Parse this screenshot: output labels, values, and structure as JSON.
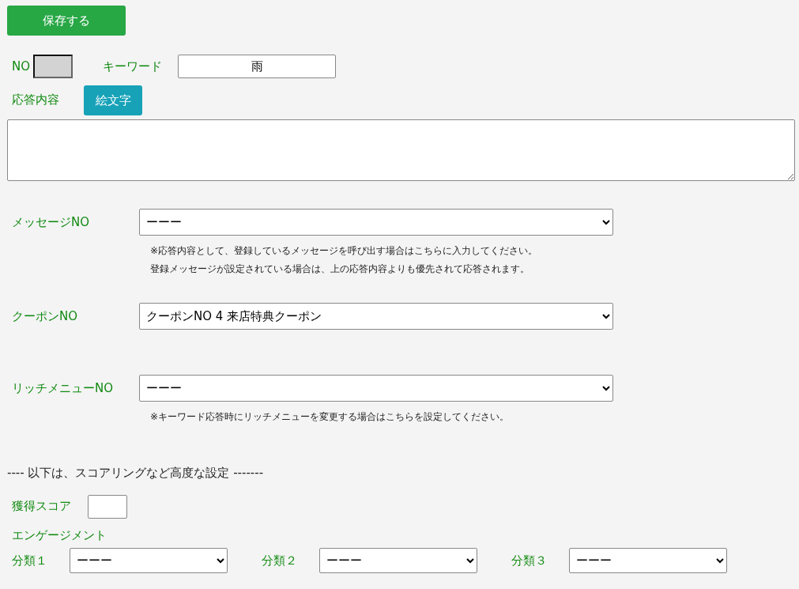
{
  "save_button": "保存する",
  "no_field": {
    "label": "NO",
    "disabled": true
  },
  "keyword": {
    "label": "キーワード",
    "value": "雨"
  },
  "response": {
    "label": "応答内容",
    "emoji_button": "絵文字"
  },
  "selects": [
    {
      "label": "メッセージNO",
      "value": "ーーー",
      "notes": [
        "※応答内容として、登録しているメッセージを呼び出す場合はこちらに入力してください。",
        "登録メッセージが設定されている場合は、上の応答内容よりも優先されて応答されます。"
      ]
    },
    {
      "label": "クーポンNO",
      "value": "クーポンNO 4 来店特典クーポン"
    },
    {
      "label": "リッチメニューNO",
      "value": "ーーー",
      "notes": [
        "※キーワード応答時にリッチメニューを変更する場合はこちらを設定してください。"
      ]
    }
  ],
  "advanced_heading": "---- 以下は、スコアリングなど高度な設定 -------",
  "score": {
    "label": "獲得スコア"
  },
  "engagement_label": "エンゲージメント",
  "categories": [
    {
      "label": "分類１",
      "value": "ーーー"
    },
    {
      "label": "分類２",
      "value": "ーーー"
    },
    {
      "label": "分類３",
      "value": "ーーー"
    }
  ]
}
